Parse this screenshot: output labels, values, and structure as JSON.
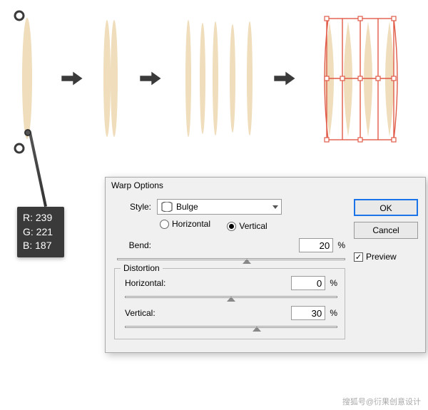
{
  "colors": {
    "shape": "#efddbb",
    "selection": "#e05a47"
  },
  "color_tooltip": {
    "r_label": "R:",
    "r_value": "239",
    "g_label": "G:",
    "g_value": "221",
    "b_label": "B:",
    "b_value": "187"
  },
  "dialog": {
    "title": "Warp Options",
    "style_label": "Style:",
    "style_value": "Bulge",
    "radio_horizontal": "Horizontal",
    "radio_vertical": "Vertical",
    "radio_selected": "vertical",
    "bend_label": "Bend:",
    "bend_value": "20",
    "distortion_legend": "Distortion",
    "dist_h_label": "Horizontal:",
    "dist_h_value": "0",
    "dist_v_label": "Vertical:",
    "dist_v_value": "30",
    "percent": "%",
    "ok": "OK",
    "cancel": "Cancel",
    "preview_label": "Preview",
    "preview_checked": true
  },
  "watermark": "搜狐号@衍果创意设计"
}
